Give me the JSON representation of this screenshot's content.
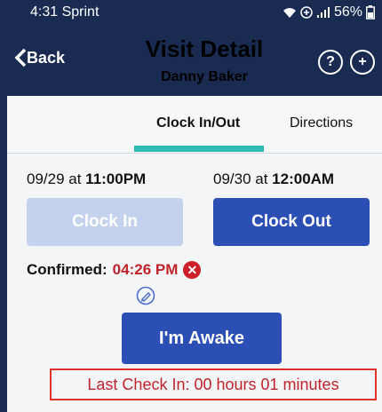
{
  "status_bar": {
    "time": "4:31",
    "carrier": "Sprint",
    "battery": "56%"
  },
  "header": {
    "back_label": "Back",
    "title": "Visit Detail",
    "subtitle": "Danny Baker"
  },
  "tabs": [
    {
      "label": "Clock In/Out",
      "active": true
    },
    {
      "label": "Directions",
      "active": false
    }
  ],
  "schedule": {
    "start_date": "09/29 at ",
    "start_time": "11:00PM",
    "end_date": "09/30 at ",
    "end_time": "12:00AM"
  },
  "buttons": {
    "clock_in": "Clock In",
    "clock_out": "Clock Out",
    "awake": "I'm Awake"
  },
  "confirmation": {
    "label": "Confirmed:",
    "time": "04:26 PM"
  },
  "last_check_in": "Last Check In: 00 hours 01 minutes",
  "colors": {
    "header_bg": "#1a2b52",
    "primary_button": "#2b4fb4",
    "disabled_button": "#c4d2ee",
    "tab_indicator": "#2fbbb4",
    "alert_red": "#c0242b"
  }
}
